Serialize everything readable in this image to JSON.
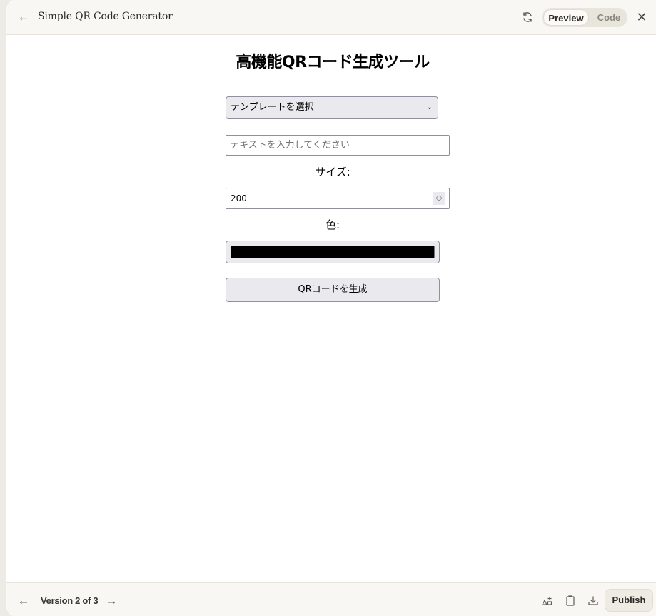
{
  "header": {
    "title": "Simple QR Code Generator",
    "back_icon": "arrow-left-icon",
    "refresh_icon": "refresh-icon",
    "tabs": [
      {
        "label": "Preview",
        "active": true
      },
      {
        "label": "Code",
        "active": false
      }
    ],
    "close_icon": "close-icon"
  },
  "app": {
    "title": "高機能QRコード生成ツール",
    "template_select": {
      "selected": "テンプレートを選択"
    },
    "text_input": {
      "value": "",
      "placeholder": "テキストを入力してください"
    },
    "size_label": "サイズ:",
    "size_input": {
      "value": "200"
    },
    "color_label": "色:",
    "color_input": {
      "value": "#000000"
    },
    "generate_button": "QRコードを生成"
  },
  "footer": {
    "version_label": "Version 2 of 3",
    "prev_icon": "arrow-left-icon",
    "next_icon": "arrow-right-icon",
    "icons": [
      "shapes-icon",
      "clipboard-icon",
      "download-icon"
    ],
    "publish_label": "Publish"
  }
}
